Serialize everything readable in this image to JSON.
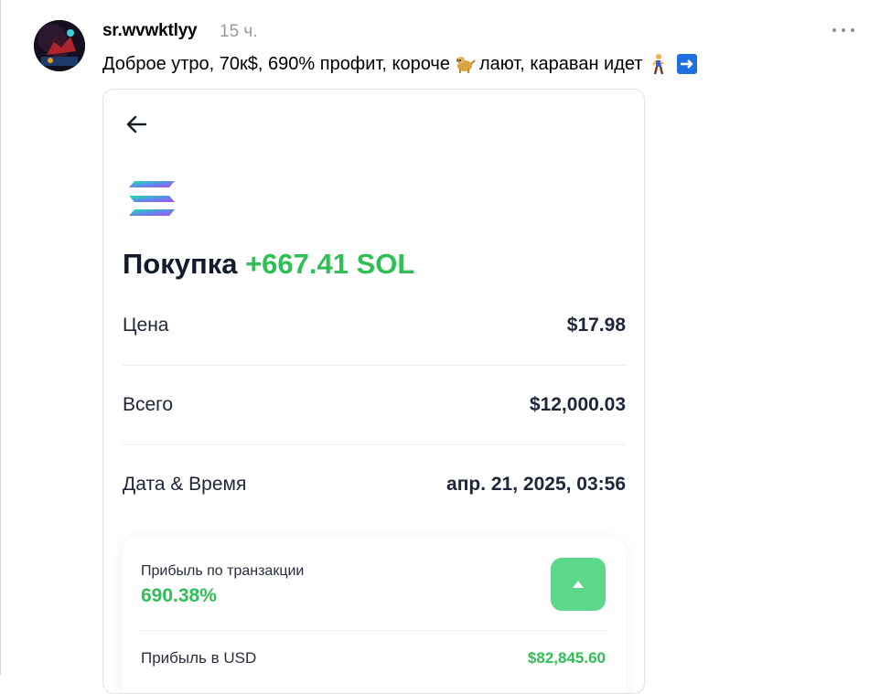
{
  "post": {
    "username": "sr.wvwktlyy",
    "time": "15 ч.",
    "text_part1": "Доброе утро, 70к$, 690% профит, короче",
    "text_part2": "лают, караван идет",
    "emojis": [
      "dog-emoji",
      "person-walking-emoji",
      "right-arrow-emoji"
    ]
  },
  "card": {
    "title_prefix": "Покупка",
    "title_amount": "+667.41 SOL",
    "rows": [
      {
        "label": "Цена",
        "value": "$17.98"
      },
      {
        "label": "Всего",
        "value": "$12,000.03"
      },
      {
        "label": "Дата & Время",
        "value": "апр. 21, 2025, 03:56"
      }
    ],
    "profit": {
      "tx_label": "Прибыль по транзакции",
      "tx_value": "690.38%",
      "usd_label": "Прибыль в USD",
      "usd_value": "$82,845.60"
    }
  },
  "colors": {
    "accent_green": "#2fbf55",
    "button_green": "#5cd88a",
    "title_dark": "#141a2e"
  },
  "icons": [
    "more-icon",
    "back-arrow-icon",
    "solana-logo-icon",
    "triangle-up-icon"
  ]
}
